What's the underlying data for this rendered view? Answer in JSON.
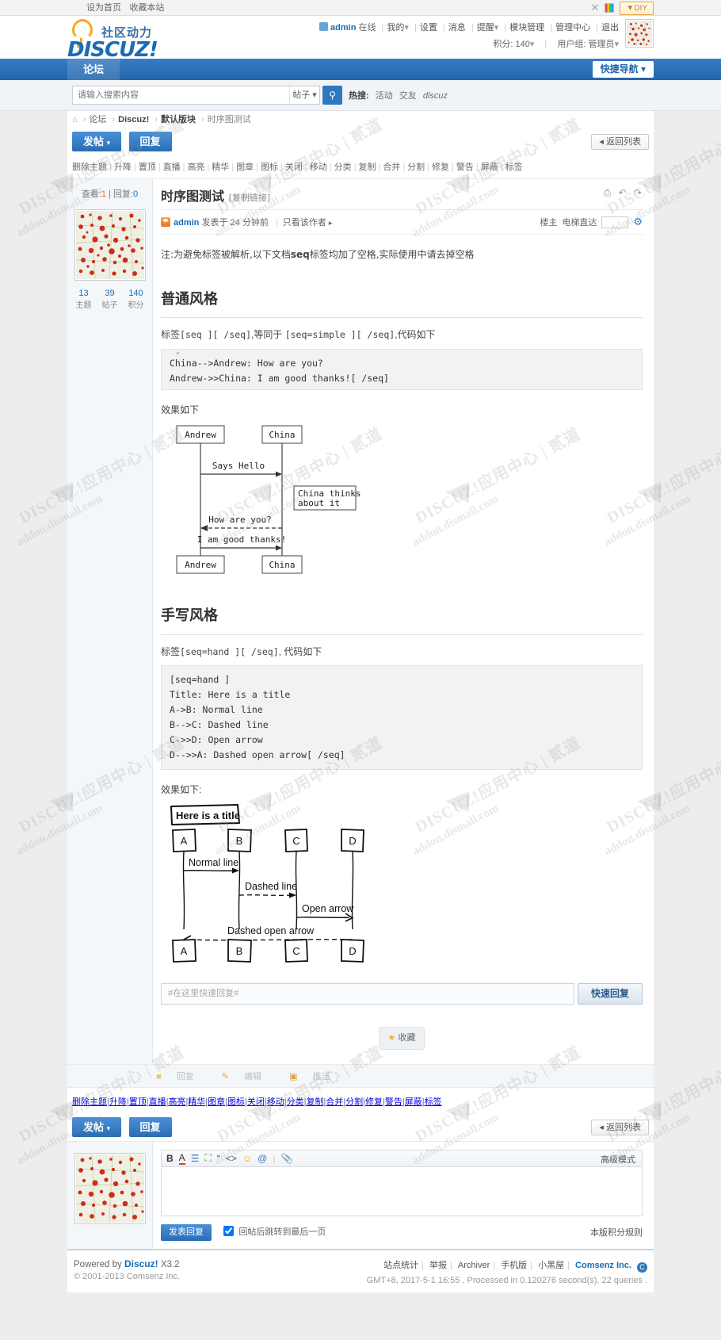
{
  "topbar": {
    "set_home": "设为首页",
    "favorite": "收藏本站",
    "diy": "DIY",
    "shuffle_icon": "shuffle-icon",
    "palette_icon": "palette-icon"
  },
  "header": {
    "logo_cn": "社区动力",
    "logo_brand": "DISCUZ!",
    "user": {
      "name": "admin",
      "status": "在线",
      "mine": "我的",
      "settings": "设置",
      "messages": "消息",
      "notice": "提醒",
      "module_manage": "模块管理",
      "admin_center": "管理中心",
      "logout": "退出",
      "credits_label": "积分:",
      "credits_value": "140",
      "group_label": "用户组:",
      "group_value": "管理员"
    }
  },
  "nav": {
    "tab": "论坛",
    "quick_nav": "快捷导航"
  },
  "search": {
    "placeholder": "请输入搜索内容",
    "type": "帖子",
    "hot_label": "热搜:",
    "hot_items": [
      "活动",
      "交友",
      "discuz"
    ]
  },
  "breadcrumb": {
    "home_icon": "home-icon",
    "items": [
      "论坛",
      "Discuz!",
      "默认版块",
      "时序图测试"
    ]
  },
  "actions": {
    "post": "发帖",
    "reply": "回复",
    "back_list": "返回列表"
  },
  "moderation": [
    "删除主题",
    "升降",
    "置顶",
    "直播",
    "高亮",
    "精华",
    "图章",
    "图标",
    "关闭",
    "移动",
    "分类",
    "复制",
    "合并",
    "分割",
    "修复",
    "警告",
    "屏蔽",
    "标签"
  ],
  "post": {
    "view_label": "查看:",
    "view_count": "1",
    "reply_label": "回复:",
    "reply_count": "0",
    "title": "时序图测试",
    "copy_link": "[复制链接]",
    "tools": {
      "print_icon": "printer-icon",
      "prev_icon": "prev-icon",
      "next_icon": "next-icon"
    },
    "author": "admin",
    "posted_prefix": "发表于",
    "posted_time": "24 分钟前",
    "only_author": "只看该作者",
    "floor_label": "楼主",
    "elevator": "电梯直达",
    "wrench_icon": "wrench-icon",
    "stats": [
      {
        "num": "13",
        "label": "主题"
      },
      {
        "num": "39",
        "label": "帖子"
      },
      {
        "num": "140",
        "label": "积分"
      }
    ],
    "body": {
      "note": "注:为避免标签被解析,以下文档seq标签均加了空格,实际使用中请去掉空格",
      "note_bold": "seq",
      "section1_title": "普通风格",
      "section1_desc_a": "标签",
      "section1_desc_code1": "[seq ][ /seq]",
      "section1_desc_b": ",等同于 ",
      "section1_desc_code2": "[seq=simple ][ /seq]",
      "section1_desc_c": ",代码如下",
      "code1": "China-->Andrew: How are you?\nAndrew->>China: I am good thanks![ /seq]",
      "effect_label_1": "效果如下",
      "section2_title": "手写风格",
      "section2_desc_a": "标签",
      "section2_desc_code": "[seq=hand ][ /seq]",
      "section2_desc_c": ", 代码如下",
      "code2": "[seq=hand ]\nTitle: Here is a title\nA->B: Normal line\nB-->C: Dashed line\nC->>D: Open arrow\nD-->>A: Dashed open arrow[ /seq]",
      "effect_label_2": "效果如下:"
    }
  },
  "diagram_simple": {
    "actors": [
      "Andrew",
      "China"
    ],
    "messages": [
      {
        "from": "Andrew",
        "to": "China",
        "label": "Says Hello",
        "style": "solid"
      },
      {
        "from": "China",
        "to": "Andrew",
        "label": "How are you?",
        "style": "dashed"
      },
      {
        "from": "Andrew",
        "to": "China",
        "label": "I am good thanks!",
        "style": "solid"
      }
    ],
    "notes": [
      {
        "over": "China",
        "text": "China thinks\nabout it"
      }
    ]
  },
  "diagram_hand": {
    "title": "Here is a title",
    "actors": [
      "A",
      "B",
      "C",
      "D"
    ],
    "messages": [
      {
        "from": "A",
        "to": "B",
        "label": "Normal line",
        "style": "solid-arrow"
      },
      {
        "from": "B",
        "to": "C",
        "label": "Dashed line",
        "style": "dashed-arrow"
      },
      {
        "from": "C",
        "to": "D",
        "label": "Open arrow",
        "style": "solid-open"
      },
      {
        "from": "D",
        "to": "A",
        "label": "Dashed open arrow",
        "style": "dashed-open"
      }
    ]
  },
  "quick_reply": {
    "placeholder": "#在这里快速回复#",
    "button": "快速回复"
  },
  "favorite": {
    "star_icon": "star-icon",
    "label": "收藏"
  },
  "post_footer_actions": [
    {
      "icon": "reply-icon",
      "label": "回复"
    },
    {
      "icon": "edit-icon",
      "label": "编辑"
    },
    {
      "icon": "push-icon",
      "label": "推送"
    }
  ],
  "editor": {
    "toolbar_icons": [
      "bold-icon",
      "text-color-icon",
      "align-icon",
      "image-icon",
      "quote-icon",
      "code-icon",
      "smiley-icon",
      "mention-icon",
      "attach-icon"
    ],
    "advanced": "高级模式",
    "submit": "发表回复",
    "jump_label": "回帖后跳转到最后一页",
    "rule": "本版积分规则"
  },
  "footer": {
    "powered": "Powered by",
    "brand": "Discuz!",
    "version": "X3.2",
    "copyright": "© 2001-2013 Comsenz Inc.",
    "links": [
      "站点统计",
      "举报",
      "Archiver",
      "手机版",
      "小黑屋",
      "Comsenz Inc."
    ],
    "comsenz_icon": "comsenz-icon",
    "status": "GMT+8, 2017-5-1 16:55 , Processed in 0.120276 second(s), 22 queries ."
  },
  "watermarks": {
    "a": "DISCUZ!应用中心 | 贰道",
    "b": "addon.dismall.com"
  }
}
